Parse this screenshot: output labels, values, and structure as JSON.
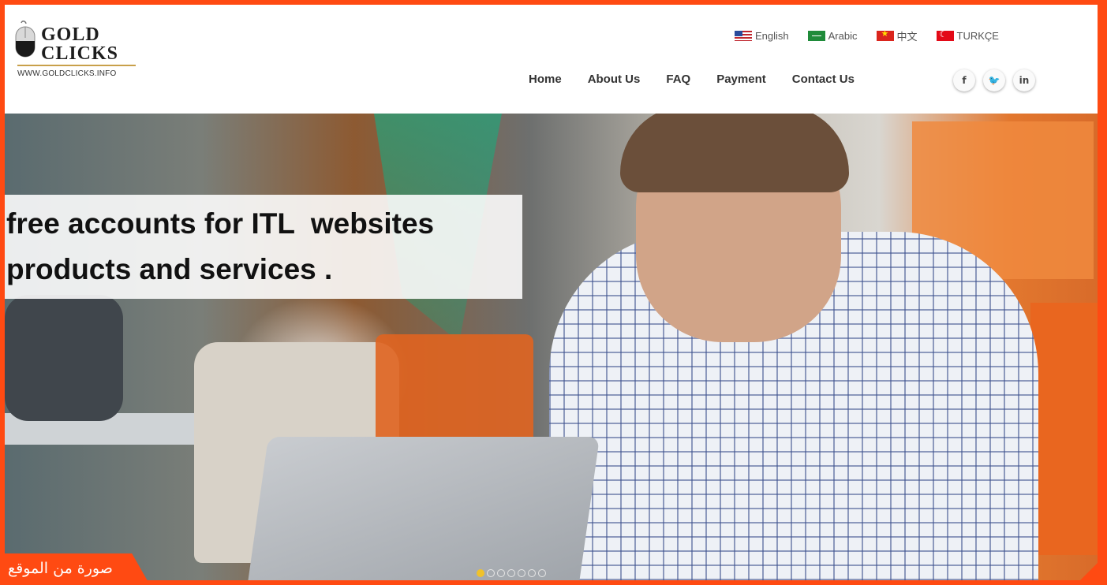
{
  "logo": {
    "line1": "GOLD",
    "line2": "CLICKS",
    "url": "WWW.GOLDCLICKS.INFO"
  },
  "languages": [
    {
      "label": "English",
      "flag": "us-flag-icon"
    },
    {
      "label": "Arabic",
      "flag": "saudi-flag-icon"
    },
    {
      "label": "中文",
      "flag": "vietnam-flag-icon"
    },
    {
      "label": "TURKÇE",
      "flag": "turkey-flag-icon"
    }
  ],
  "nav": [
    "Home",
    "About Us",
    "FAQ",
    "Payment",
    "Contact Us"
  ],
  "social": [
    {
      "icon": "facebook-icon",
      "glyph": "f"
    },
    {
      "icon": "twitter-icon",
      "glyph": "🐦"
    },
    {
      "icon": "linkedin-icon",
      "glyph": "in"
    }
  ],
  "hero": {
    "headline_line1": "free accounts for ITL  websites",
    "headline_line2": "products and services .",
    "slide_count": 7,
    "active_slide": 1
  },
  "caption": "صورة من الموقع",
  "colors": {
    "frame": "#ff4a12",
    "slider_active": "#f0c22b"
  }
}
